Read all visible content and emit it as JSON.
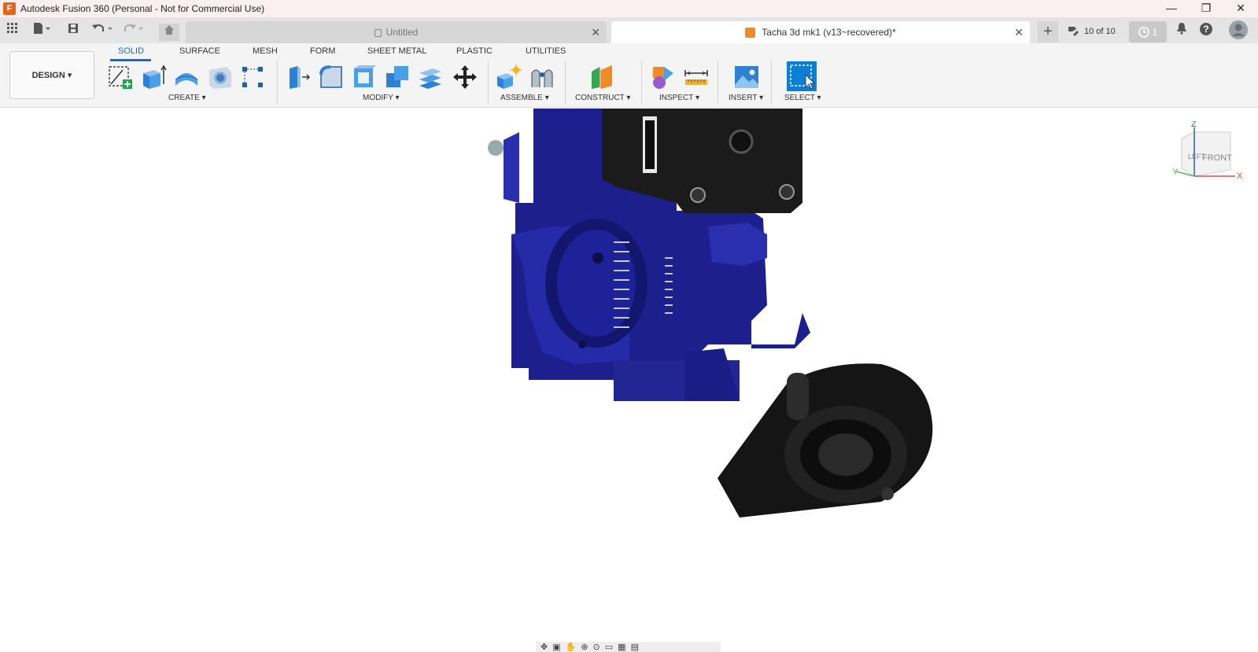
{
  "window": {
    "title": "Autodesk Fusion 360 (Personal - Not for Commercial Use)",
    "logo_letter": "F",
    "minimize": "—",
    "maximize": "❐",
    "close": "✕"
  },
  "tabs": {
    "items": [
      {
        "label": "Untitled",
        "active": false
      },
      {
        "label": "Tacha 3d mk1 (v13~recovered)*",
        "active": true
      }
    ],
    "add_label": "+",
    "version_label": "10 of 10",
    "jobs_count": "1",
    "notifications_icon": "bell-icon",
    "help_label": "?"
  },
  "toolbar": {
    "workspace_label": "DESIGN ▾",
    "workspace_tabs": [
      "SOLID",
      "SURFACE",
      "MESH",
      "FORM",
      "SHEET METAL",
      "PLASTIC",
      "UTILITIES"
    ],
    "active_tab": "SOLID",
    "groups": {
      "create": "CREATE ▾",
      "modify": "MODIFY ▾",
      "assemble": "ASSEMBLE ▾",
      "construct": "CONSTRUCT ▾",
      "inspect": "INSPECT ▾",
      "insert": "INSERT ▾",
      "select": "SELECT ▾"
    }
  },
  "viewcube": {
    "left_face": "LEFT",
    "front_face": "FRONT",
    "axis_z": "Z",
    "axis_x": "X",
    "axis_y": "Y"
  },
  "colors": {
    "accent": "#0b6fcf",
    "model_blue": "#1c1f8c",
    "model_black": "#1a1a1a",
    "brand_orange": "#e8631c"
  }
}
